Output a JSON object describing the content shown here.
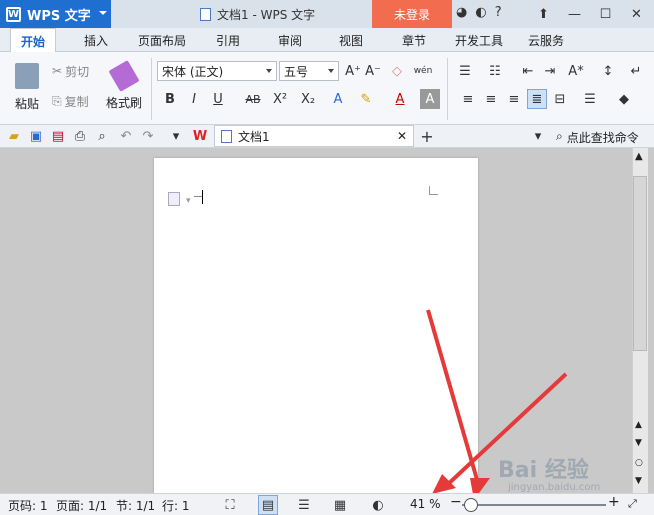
{
  "app": {
    "name": "WPS 文字",
    "window_title": "文档1 - WPS 文字",
    "login": "未登录"
  },
  "tabs": [
    "开始",
    "插入",
    "页面布局",
    "引用",
    "审阅",
    "视图",
    "章节",
    "开发工具",
    "云服务"
  ],
  "ribbon": {
    "paste": "粘贴",
    "cut": "剪切",
    "copy": "复制",
    "format_painter": "格式刷",
    "font_name": "宋体 (正文)",
    "font_size": "五号",
    "bold": "B",
    "italic": "I",
    "underline": "U",
    "strike": "AB",
    "superscript": "X²",
    "subscript": "X₂",
    "font_color": "A",
    "char_shade": "A",
    "phonetic": "wén"
  },
  "document_tab": {
    "title": "文档1",
    "search_command": "点此查找命令"
  },
  "statusbar": {
    "page_num": "页码: 1",
    "pages": "页面: 1/1",
    "section": "节: 1/1",
    "line": "行: 1",
    "zoom": "41 %",
    "zoom_level": 41
  },
  "watermark": {
    "text": "Bai 经验",
    "sub": "jingyan.baidu.com"
  }
}
